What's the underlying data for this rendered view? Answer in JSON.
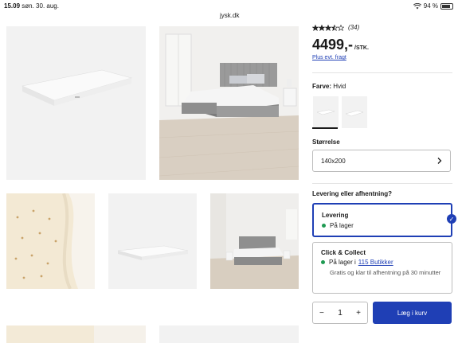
{
  "status": {
    "time": "15.09",
    "date": "søn. 30. aug.",
    "battery": "94 %"
  },
  "browser": {
    "url": "jysk.dk"
  },
  "product": {
    "rating_count": "(34)",
    "rating_value": 3.5,
    "price": "4499,-",
    "price_unit": "/STK.",
    "freight_link": "Plus evt. fragt"
  },
  "color": {
    "label": "Farve:",
    "value": "Hvid"
  },
  "size": {
    "label": "Størrelse",
    "value": "140x200"
  },
  "delivery": {
    "question": "Levering eller afhentning?",
    "options": [
      {
        "title": "Levering",
        "status": "På lager"
      },
      {
        "title": "Click & Collect",
        "status": "På lager i",
        "stores_link": "115 Butikker",
        "note": "Gratis og klar til afhentning på 30 minutter"
      }
    ]
  },
  "cart": {
    "minus": "−",
    "quantity": "1",
    "plus": "+",
    "button": "Læg i kurv"
  }
}
